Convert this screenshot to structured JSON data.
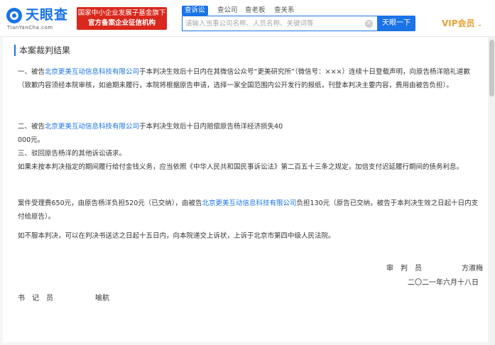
{
  "header": {
    "logo_text": "天眼查",
    "logo_sub": "TianYanCha.com",
    "banner_line1": "国家中小企业发展子基金旗下",
    "banner_line2": "官方备案企业征信机构",
    "tabs": [
      {
        "label": "查诉讼"
      },
      {
        "label": "查公司"
      },
      {
        "label": "查老板"
      },
      {
        "label": "查关系"
      }
    ],
    "search_placeholder": "请输入当事公司名称、人员名称、关键词等",
    "search_button": "天眼一下",
    "vip_label": "VIP会员"
  },
  "judgment": {
    "section_title": "本案裁判结果",
    "company_name": "北京更美互动信息科技有限公司",
    "p1_prefix": "一、被告",
    "p1_suffix": "于本判决生效后十日内在其微信公众号“更美研究所”（微信号：×××）连续十日登载声明，向原告杨洋赔礼道歉（致歉内容须经本院审核，如逾期未履行，本院将根据原告申请，选择一家全国范围内公开发行的报纸，刊登本判决主要内容，费用由被告负担）。",
    "p2_prefix": "二、被告",
    "p2_suffix": "于本判决生效后十日内赔偿原告杨洋经济损失40",
    "p2_line2": "000元。",
    "p3": "三、驳回原告杨洋的其他诉讼请求。",
    "p4": "如果未按本判决指定的期间履行给付金钱义务，应当依照《中华人民共和国民事诉讼法》第二百五十三条之规定，加倍支付迟延履行期间的债务利息。",
    "p5_prefix": "案件受理费650元，由原告杨洋负担520元（已交纳），由被告",
    "p5_suffix": "负担130元（原告已交纳，被告于本判决生效之日起十日内支付给原告）。",
    "p6": "如不服本判决，可以在判决书送达之日起十五日内，向本院递交上诉状，上诉于北京市第四中级人民法院。",
    "judge_title": "审　判　员",
    "judge_name": "方淑梅",
    "date": "二〇二一年六月十八日",
    "clerk_title": "书　记　员",
    "clerk_name": "喻航"
  }
}
